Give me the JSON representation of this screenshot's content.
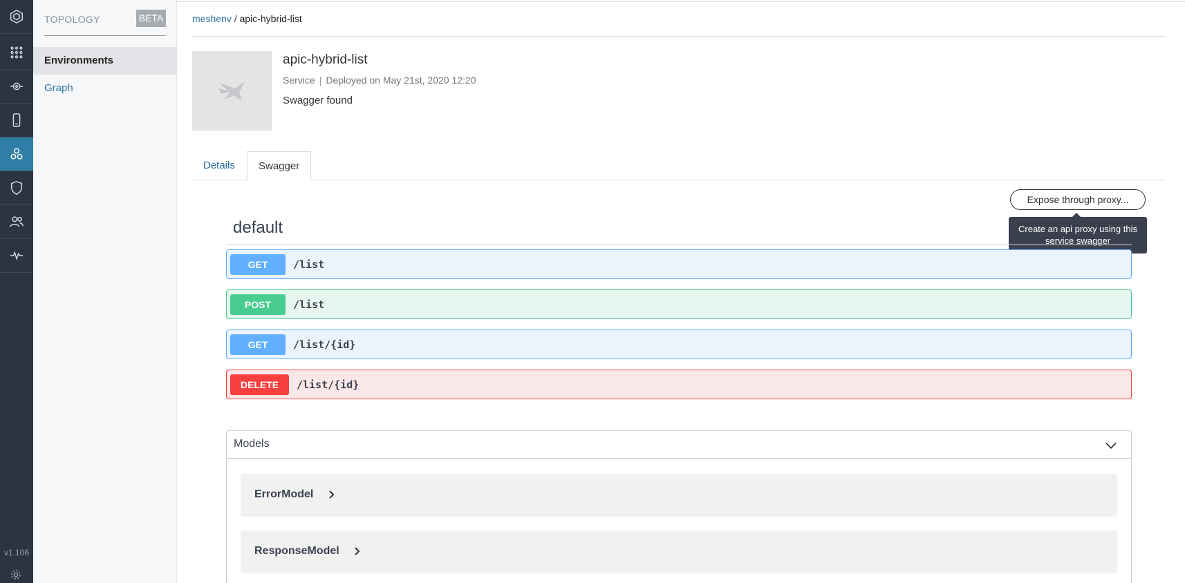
{
  "rail": {
    "items": [
      {
        "icon": "logo-hex-icon"
      },
      {
        "icon": "apps-grid-icon"
      },
      {
        "icon": "api-target-icon"
      },
      {
        "icon": "mobile-device-icon"
      },
      {
        "icon": "topology-nodes-icon",
        "active": true
      },
      {
        "icon": "shield-icon"
      },
      {
        "icon": "users-icon"
      },
      {
        "icon": "pulse-activity-icon"
      }
    ],
    "version": "v1.106",
    "bottom_icon": "settings-gear-icon"
  },
  "sidebar": {
    "title": "TOPOLOGY",
    "badge": "BETA",
    "items": [
      {
        "label": "Environments",
        "selected": true
      },
      {
        "label": "Graph",
        "selected": false
      }
    ]
  },
  "breadcrumb": {
    "parent": "meshenv",
    "separator": "/",
    "current": "apic-hybrid-list"
  },
  "service": {
    "name": "apic-hybrid-list",
    "type": "Service",
    "separator": "|",
    "deployed": "Deployed on May 21st, 2020 12:20",
    "status": "Swagger found"
  },
  "tabs": {
    "details": "Details",
    "swagger": "Swagger",
    "active": "Swagger"
  },
  "expose": {
    "button_label": "Expose through proxy...",
    "tooltip_line1": "Create an api proxy using this",
    "tooltip_line2": "service swagger"
  },
  "swagger": {
    "group": "default",
    "operations": [
      {
        "method": "GET",
        "path": "/list"
      },
      {
        "method": "POST",
        "path": "/list"
      },
      {
        "method": "GET",
        "path": "/list/{id}"
      },
      {
        "method": "DELETE",
        "path": "/list/{id}"
      }
    ],
    "models_title": "Models",
    "models": [
      {
        "name": "ErrorModel"
      },
      {
        "name": "ResponseModel"
      }
    ]
  },
  "colors": {
    "rail_bg": "#2d3441",
    "rail_active": "#2e7ea6",
    "link": "#2b6fa0",
    "get": "#61affe",
    "post": "#49cc90",
    "delete": "#f93e3e"
  }
}
